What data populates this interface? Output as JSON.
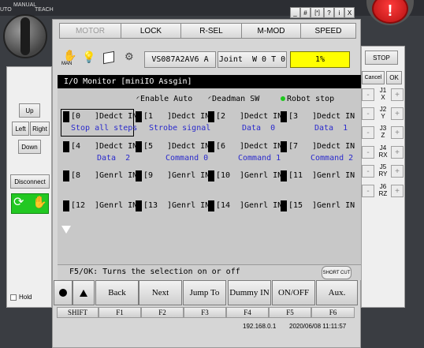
{
  "titlebar": {
    "left_label": "UTO",
    "manual_label": "MANUAL",
    "teach_label": "TEACH",
    "window_buttons": [
      "_",
      "#",
      "[*]",
      "?",
      "i",
      "X"
    ]
  },
  "top_buttons": [
    "MOTOR",
    "LOCK",
    "R-SEL",
    "M-MOD",
    "SPEED"
  ],
  "status": {
    "man_label": "MAN",
    "robot_model": "VS087A2AV6 A",
    "joint_label": "Joint  W 0 T 0",
    "speed": "1%"
  },
  "panel": {
    "title": "I/O Monitor [miniIO Assgin]",
    "options": [
      "Enable Auto",
      "Deadman SW",
      "Robot stop"
    ],
    "io_rows": [
      {
        "cells": [
          {
            "num": "[0",
            "label": "]Dedct IN"
          },
          {
            "num": "[1",
            "label": "]Dedct IN"
          },
          {
            "num": "[2",
            "label": "]Dedct IN"
          },
          {
            "num": "[3",
            "label": "]Dedct IN"
          }
        ],
        "subs": [
          "Stop all steps",
          "Strobe signal",
          "Data  0",
          "Data  1"
        ]
      },
      {
        "cells": [
          {
            "num": "[4",
            "label": "]Dedct IN"
          },
          {
            "num": "[5",
            "label": "]Dedct IN"
          },
          {
            "num": "[6",
            "label": "]Dedct IN"
          },
          {
            "num": "[7",
            "label": "]Dedct IN"
          }
        ],
        "subs": [
          "Data  2",
          "Command 0",
          "Command 1",
          "Command 2"
        ]
      },
      {
        "cells": [
          {
            "num": "[8",
            "label": "]Genrl IN"
          },
          {
            "num": "[9",
            "label": "]Genrl IN"
          },
          {
            "num": "[10",
            "label": "]Genrl IN"
          },
          {
            "num": "[11",
            "label": "]Genrl IN"
          }
        ],
        "subs": [
          "",
          "",
          "",
          ""
        ]
      },
      {
        "cells": [
          {
            "num": "[12",
            "label": "]Genrl IN"
          },
          {
            "num": "[13",
            "label": "]Genrl IN"
          },
          {
            "num": "[14",
            "label": "]Genrl IN"
          },
          {
            "num": "[15",
            "label": "]Genrl IN"
          }
        ],
        "subs": [
          "",
          "",
          "",
          ""
        ]
      }
    ],
    "hint": "F5/OK: Turns the selection on or off",
    "shortcut_label": "SHORT CUT"
  },
  "left_panel": {
    "up": "Up",
    "left": "Left",
    "right": "Right",
    "down": "Down",
    "disconnect": "Disconnect",
    "hold": "Hold"
  },
  "fkeys": [
    "Back",
    "Next",
    "Jump To",
    "Dummy IN",
    "ON/OFF",
    "Aux."
  ],
  "fkey_labels": [
    "SHIFT",
    "F1",
    "F2",
    "F3",
    "F4",
    "F5",
    "F6"
  ],
  "footer": {
    "ip": "192.168.0.1",
    "datetime": "2020/06/08 11:11:57"
  },
  "right_panel": {
    "stop": "STOP",
    "cancel": "Cancel",
    "ok": "OK",
    "joints": [
      {
        "name": "J1",
        "axis": "X"
      },
      {
        "name": "J2",
        "axis": "Y"
      },
      {
        "name": "J3",
        "axis": "Z"
      },
      {
        "name": "J4",
        "axis": "RX"
      },
      {
        "name": "J5",
        "axis": "RY"
      },
      {
        "name": "J6",
        "axis": "RZ"
      }
    ]
  },
  "colors": {
    "panel_bg": "#c8c8c8",
    "title_bar": "#000000",
    "io_sub_text": "#2a2acc",
    "speed_yellow": "#ffff00",
    "estop_red": "#d41a1a",
    "green_button": "#22c822"
  }
}
